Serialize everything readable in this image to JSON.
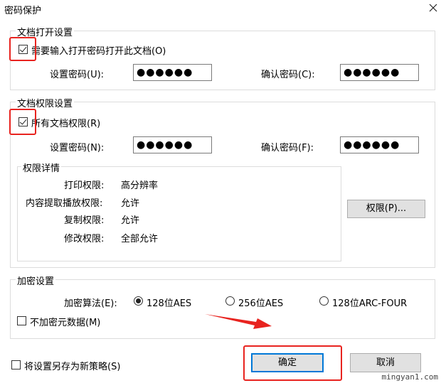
{
  "window": {
    "title": "密码保护"
  },
  "open_settings": {
    "legend": "文档打开设置",
    "require_password_label": "需要输入打开密码打开此文档(O)",
    "require_password_checked": true,
    "set_password_label": "设置密码(U):",
    "set_password_value": "●●●●●●",
    "confirm_password_label": "确认密码(C):",
    "confirm_password_value": "●●●●●●"
  },
  "permission_settings": {
    "legend": "文档权限设置",
    "all_permissions_label": "所有文档权限(R)",
    "all_permissions_checked": true,
    "set_password_label": "设置密码(N):",
    "set_password_value": "●●●●●●",
    "confirm_password_label": "确认密码(F):",
    "confirm_password_value": "●●●●●●",
    "details": {
      "legend": "权限详情",
      "rows": [
        {
          "label": "打印权限:",
          "value": "高分辨率"
        },
        {
          "label": "内容提取播放权限:",
          "value": "允许"
        },
        {
          "label": "复制权限:",
          "value": "允许"
        },
        {
          "label": "修改权限:",
          "value": "全部允许"
        }
      ]
    },
    "permissions_button": "权限(P)..."
  },
  "encryption": {
    "legend": "加密设置",
    "algorithm_label": "加密算法(E):",
    "options": [
      "128位AES",
      "256位AES",
      "128位ARC-FOUR"
    ],
    "selected_index": 0,
    "no_metadata_label": "不加密元数据(M)",
    "no_metadata_checked": false
  },
  "footer": {
    "save_as_policy_label": "将设置另存为新策略(S)",
    "save_as_policy_checked": false,
    "ok_label": "确定",
    "cancel_label": "取消"
  },
  "watermark": "mingyan1.com",
  "colors": {
    "highlight": "#e8231f",
    "focus": "#0078d7",
    "button_bg": "#e1e1e1"
  }
}
